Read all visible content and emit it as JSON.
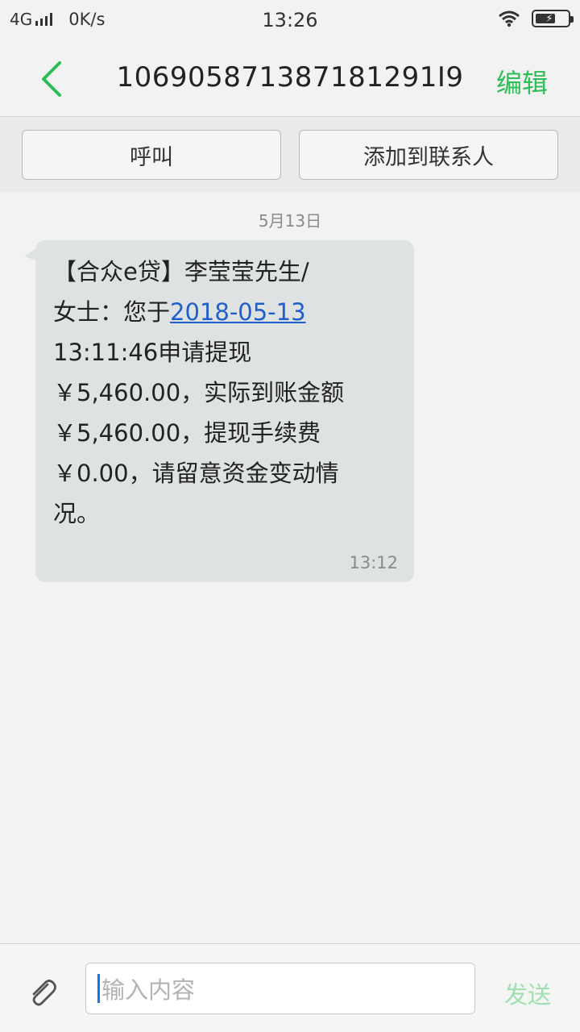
{
  "status_bar": {
    "network": "4G",
    "speed": "0K/s",
    "time": "13:26",
    "icons": [
      "signal-icon",
      "wifi-icon",
      "battery-charging-icon"
    ]
  },
  "header": {
    "title": "106905871387181291I9",
    "edit_label": "编辑",
    "accent_color": "#2dbd56"
  },
  "actions": {
    "call_label": "呼叫",
    "add_contact_label": "添加到联系人"
  },
  "conversation": {
    "date": "5月13日",
    "message": {
      "line1": "【合众e贷】李莹莹先生/",
      "line2_prefix": "女士：您于",
      "line2_link": "2018-05-13",
      "line3": "13:11:46申请提现",
      "line4": "￥5,460.00，实际到账金额",
      "line5": "￥5,460.00，提现手续费",
      "line6": "￥0.00，请留意资金变动情",
      "line7": "况。",
      "time": "13:12"
    }
  },
  "composer": {
    "placeholder": "输入内容",
    "send_label": "发送"
  }
}
